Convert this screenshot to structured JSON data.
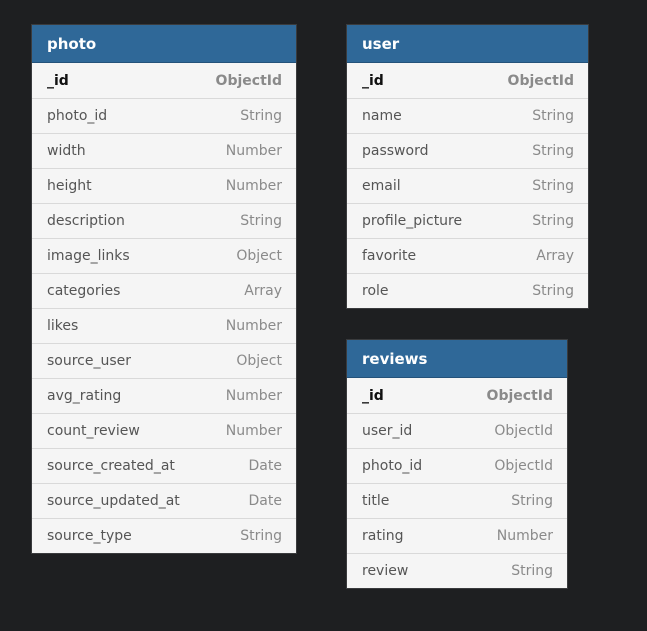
{
  "tables": [
    {
      "id": "photo",
      "title": "photo",
      "fields": [
        {
          "name": "_id",
          "type": "ObjectId",
          "pk": true
        },
        {
          "name": "photo_id",
          "type": "String"
        },
        {
          "name": "width",
          "type": "Number"
        },
        {
          "name": "height",
          "type": "Number"
        },
        {
          "name": "description",
          "type": "String"
        },
        {
          "name": "image_links",
          "type": "Object"
        },
        {
          "name": "categories",
          "type": "Array"
        },
        {
          "name": "likes",
          "type": "Number"
        },
        {
          "name": "source_user",
          "type": "Object"
        },
        {
          "name": "avg_rating",
          "type": "Number"
        },
        {
          "name": "count_review",
          "type": "Number"
        },
        {
          "name": "source_created_at",
          "type": "Date"
        },
        {
          "name": "source_updated_at",
          "type": "Date"
        },
        {
          "name": "source_type",
          "type": "String"
        }
      ]
    },
    {
      "id": "user",
      "title": "user",
      "fields": [
        {
          "name": "_id",
          "type": "ObjectId",
          "pk": true
        },
        {
          "name": "name",
          "type": "String"
        },
        {
          "name": "password",
          "type": "String"
        },
        {
          "name": "email",
          "type": "String"
        },
        {
          "name": "profile_picture",
          "type": "String"
        },
        {
          "name": "favorite",
          "type": "Array"
        },
        {
          "name": "role",
          "type": "String"
        }
      ]
    },
    {
      "id": "reviews",
      "title": "reviews",
      "fields": [
        {
          "name": "_id",
          "type": "ObjectId",
          "pk": true
        },
        {
          "name": "user_id",
          "type": "ObjectId"
        },
        {
          "name": "photo_id",
          "type": "ObjectId"
        },
        {
          "name": "title",
          "type": "String"
        },
        {
          "name": "rating",
          "type": "Number"
        },
        {
          "name": "review",
          "type": "String"
        }
      ]
    }
  ],
  "colors": {
    "background": "#1e1f21",
    "header": "#2f6898",
    "body": "#f5f5f5"
  }
}
